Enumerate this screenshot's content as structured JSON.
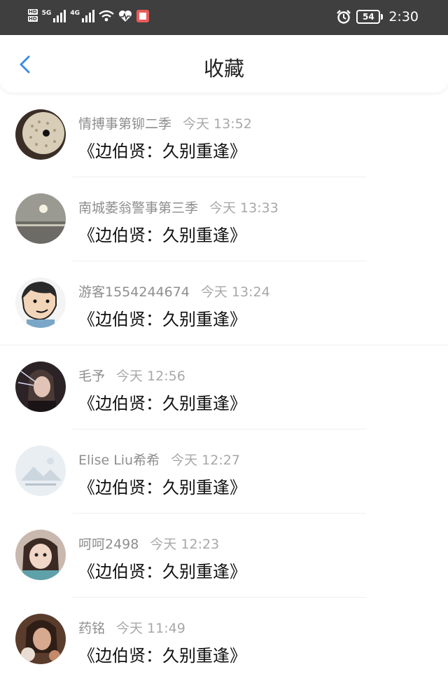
{
  "status_bar": {
    "network_a": "5G",
    "network_b": "4G",
    "battery": "54",
    "time": "2:30"
  },
  "header": {
    "title": "收藏"
  },
  "items": [
    {
      "name": "情搏事第铆二季",
      "time": "今天 13:52",
      "content": "《边伯贤：久别重逢》"
    },
    {
      "name": "南城萎翁警事第三季",
      "time": "今天 13:33",
      "content": "《边伯贤：久别重逢》"
    },
    {
      "name": "游客1554244674",
      "time": "今天 13:24",
      "content": "《边伯贤：久别重逢》"
    },
    {
      "name": "毛予",
      "time": "今天 12:56",
      "content": "《边伯贤：久别重逢》"
    },
    {
      "name": "Elise Liu希希",
      "time": "今天 12:27",
      "content": "《边伯贤：久别重逢》"
    },
    {
      "name": "呵呵2498",
      "time": "今天 12:23",
      "content": "《边伯贤：久别重逢》"
    },
    {
      "name": "药铭",
      "time": "今天 11:49",
      "content": "《边伯贤：久别重逢》"
    }
  ],
  "colors": {
    "status_bar_bg": "#3f3f3f",
    "accent": "#3a8ee6",
    "name_gray": "#8e8e8e"
  }
}
